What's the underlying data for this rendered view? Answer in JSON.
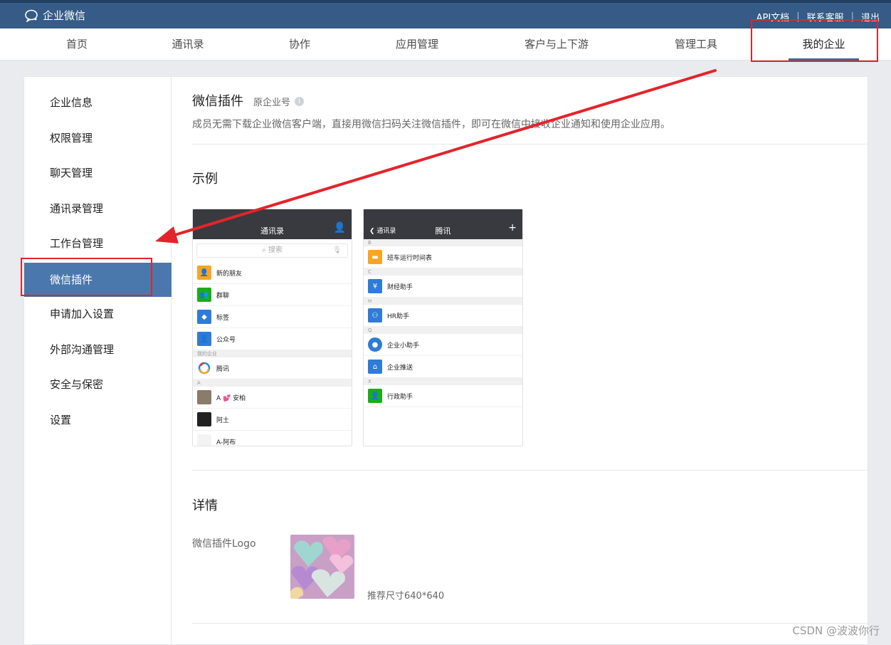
{
  "header": {
    "brand_name": "企业微信",
    "links": [
      "API文档",
      "联系客服",
      "退出"
    ]
  },
  "nav": {
    "items": [
      "首页",
      "通讯录",
      "协作",
      "应用管理",
      "客户与上下游",
      "管理工具",
      "我的企业"
    ],
    "active": "我的企业"
  },
  "sidebar": {
    "items": [
      "企业信息",
      "权限管理",
      "聊天管理",
      "通讯录管理",
      "工作台管理",
      "微信插件",
      "申请加入设置",
      "外部沟通管理",
      "安全与保密",
      "设置"
    ],
    "active": "微信插件"
  },
  "main": {
    "title": "微信插件",
    "subtitle": "原企业号",
    "description": "成员无需下载企业微信客户端，直接用微信扫码关注微信插件，即可在微信中接收企业通知和使用企业应用。",
    "example_title": "示例",
    "detail_title": "详情",
    "logo_label": "微信插件Logo",
    "logo_note": "推荐尺寸640*640"
  },
  "phone1": {
    "title": "通讯录",
    "search_placeholder": "搜索",
    "rows": [
      "新的朋友",
      "群聊",
      "标签",
      "公众号"
    ],
    "section_my_company": "我的企业",
    "company": "腾讯",
    "section_a": "A",
    "contacts": [
      "A 💕 安柏",
      "阿土",
      "A-阿布"
    ]
  },
  "phone2": {
    "back_label": "通讯录",
    "title": "腾讯",
    "groups": [
      {
        "letter": "B",
        "items": [
          "班车运行时间表"
        ]
      },
      {
        "letter": "C",
        "items": [
          "财经助手"
        ]
      },
      {
        "letter": "H",
        "items": [
          "HR助手"
        ]
      },
      {
        "letter": "Q",
        "items": [
          "企业小助手",
          "企业推送"
        ]
      },
      {
        "letter": "X",
        "items": [
          "行政助手"
        ]
      }
    ]
  },
  "watermark": "CSDN @波波你行",
  "colors": {
    "header_bg": "#355b86",
    "active_sidebar": "#4a78ad",
    "annotation_red": "#e3242b"
  }
}
